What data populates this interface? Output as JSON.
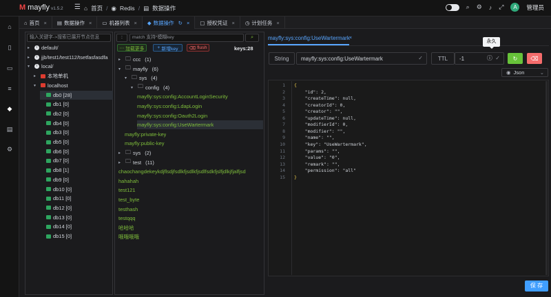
{
  "app": {
    "logo_text": "mayfly",
    "version": "v1.5.2"
  },
  "breadcrumb": [
    {
      "icon": "home-icon",
      "label": "首页"
    },
    {
      "icon": "redis-icon",
      "label": "Redis"
    },
    {
      "icon": "data-icon",
      "label": "数据操作"
    }
  ],
  "user": {
    "avatar_letter": "A",
    "name": "管理员"
  },
  "tabs": [
    {
      "label": "首页",
      "icon": "home-icon",
      "active": false
    },
    {
      "label": "数据操作",
      "icon": "data-icon",
      "active": false
    },
    {
      "label": "机器列表",
      "icon": "monitor-icon",
      "active": false
    },
    {
      "label": "数据操作",
      "icon": "redis-icon",
      "active": true
    },
    {
      "label": "授权凭证",
      "icon": "lock-icon",
      "active": false
    },
    {
      "label": "计划任务",
      "icon": "clock-icon",
      "active": false
    }
  ],
  "panel1": {
    "search_placeholder": "输入关键字->搜索已展开节点信息",
    "nodes": [
      {
        "label": "default/",
        "caret": "▸",
        "indent": 0,
        "type": "info"
      },
      {
        "label": "jjb/test1/test112/tsetfasfasdfa",
        "caret": "▸",
        "indent": 0,
        "type": "info"
      },
      {
        "label": "local/",
        "caret": "▾",
        "indent": 0,
        "type": "info"
      },
      {
        "label": "本地单机",
        "caret": "▸",
        "indent": 1,
        "type": "redis"
      },
      {
        "label": "localhost",
        "caret": "▾",
        "indent": 1,
        "type": "redis"
      },
      {
        "label": "db0 [28]",
        "indent": 2,
        "type": "db",
        "selected": true
      },
      {
        "label": "db1 [0]",
        "indent": 2,
        "type": "db"
      },
      {
        "label": "db2 [0]",
        "indent": 2,
        "type": "db"
      },
      {
        "label": "db4 [0]",
        "indent": 2,
        "type": "db"
      },
      {
        "label": "db3 [0]",
        "indent": 2,
        "type": "db"
      },
      {
        "label": "db5 [0]",
        "indent": 2,
        "type": "db"
      },
      {
        "label": "db6 [0]",
        "indent": 2,
        "type": "db"
      },
      {
        "label": "db7 [0]",
        "indent": 2,
        "type": "db"
      },
      {
        "label": "db8 [1]",
        "indent": 2,
        "type": "db"
      },
      {
        "label": "db9 [0]",
        "indent": 2,
        "type": "db"
      },
      {
        "label": "db10 [0]",
        "indent": 2,
        "type": "db"
      },
      {
        "label": "db11 [0]",
        "indent": 2,
        "type": "db"
      },
      {
        "label": "db12 [0]",
        "indent": 2,
        "type": "db"
      },
      {
        "label": "db13 [0]",
        "indent": 2,
        "type": "db"
      },
      {
        "label": "db14 [0]",
        "indent": 2,
        "type": "db"
      },
      {
        "label": "db15 [0]",
        "indent": 2,
        "type": "db"
      }
    ]
  },
  "panel2": {
    "separator": ":",
    "match_placeholder": "match 支持*模糊key",
    "load_more": "加载更多",
    "new_key": "新增key",
    "flush": "flush",
    "keys_count": "keys:28",
    "nodes": [
      {
        "label": "ccc",
        "count": "(1)",
        "caret": "▸",
        "indent": 0,
        "kind": "folder"
      },
      {
        "label": "mayfly",
        "count": "(6)",
        "caret": "▾",
        "indent": 0,
        "kind": "folder"
      },
      {
        "label": "sys",
        "count": "(4)",
        "caret": "▾",
        "indent": 1,
        "kind": "folder"
      },
      {
        "label": "config",
        "count": "(4)",
        "caret": "▾",
        "indent": 2,
        "kind": "folder"
      },
      {
        "label": "mayfly:sys:config:AccountLoginSecurity",
        "indent": 3,
        "kind": "key"
      },
      {
        "label": "mayfly:sys:config:LdapLogin",
        "indent": 3,
        "kind": "key"
      },
      {
        "label": "mayfly:sys:config:Oauth2Login",
        "indent": 3,
        "kind": "key"
      },
      {
        "label": "mayfly:sys:config:UseWartermark",
        "indent": 3,
        "kind": "key",
        "selected": true
      },
      {
        "label": "mayfly:private-key",
        "indent": 1,
        "kind": "key"
      },
      {
        "label": "mayfly:public-key",
        "indent": 1,
        "kind": "key"
      },
      {
        "label": "sys",
        "count": "(2)",
        "caret": "▸",
        "indent": 0,
        "kind": "folder"
      },
      {
        "label": "test",
        "count": "(11)",
        "caret": "▸",
        "indent": 0,
        "kind": "folder"
      },
      {
        "label": "chaochangdekeykdjflsdjfsdlkfjsdlkfjsdlfsdkfjslfjdlkjfjalfjsd",
        "indent": 0,
        "kind": "key"
      },
      {
        "label": "hahahah",
        "indent": 0,
        "kind": "key"
      },
      {
        "label": "test121",
        "indent": 0,
        "kind": "key"
      },
      {
        "label": "test_byte",
        "indent": 0,
        "kind": "key"
      },
      {
        "label": "testhash",
        "indent": 0,
        "kind": "key"
      },
      {
        "label": "testqqq",
        "indent": 0,
        "kind": "key"
      },
      {
        "label": "哈哈哈",
        "indent": 0,
        "kind": "key"
      },
      {
        "label": "哦哦哦哦",
        "indent": 0,
        "kind": "key"
      }
    ]
  },
  "panel3": {
    "key_tab": "mayfly:sys:config:UseWartermark",
    "type": "String",
    "key_name": "mayfly:sys:config:UseWartermark",
    "ttl_label": "TTL",
    "ttl_value": "-1",
    "tooltip": "永久",
    "format": "Json",
    "save": "保 存",
    "code_lines": [
      "{",
      "    \"id\": 2,",
      "    \"createTime\": null,",
      "    \"creatorId\": 0,",
      "    \"creator\": \"\",",
      "    \"updateTime\": null,",
      "    \"modifierId\": 0,",
      "    \"modifier\": \"\",",
      "    \"name\": \"\",",
      "    \"key\": \"UseWartermark\",",
      "    \"params\": \"\",",
      "    \"value\": \"0\",",
      "    \"remark\": \"\",",
      "    \"permission\": \"all\"",
      "}"
    ]
  },
  "colors": {
    "accent": "#409eff",
    "green_key": "#7fbf3b",
    "success": "#67c23a",
    "danger": "#f56c6c"
  }
}
